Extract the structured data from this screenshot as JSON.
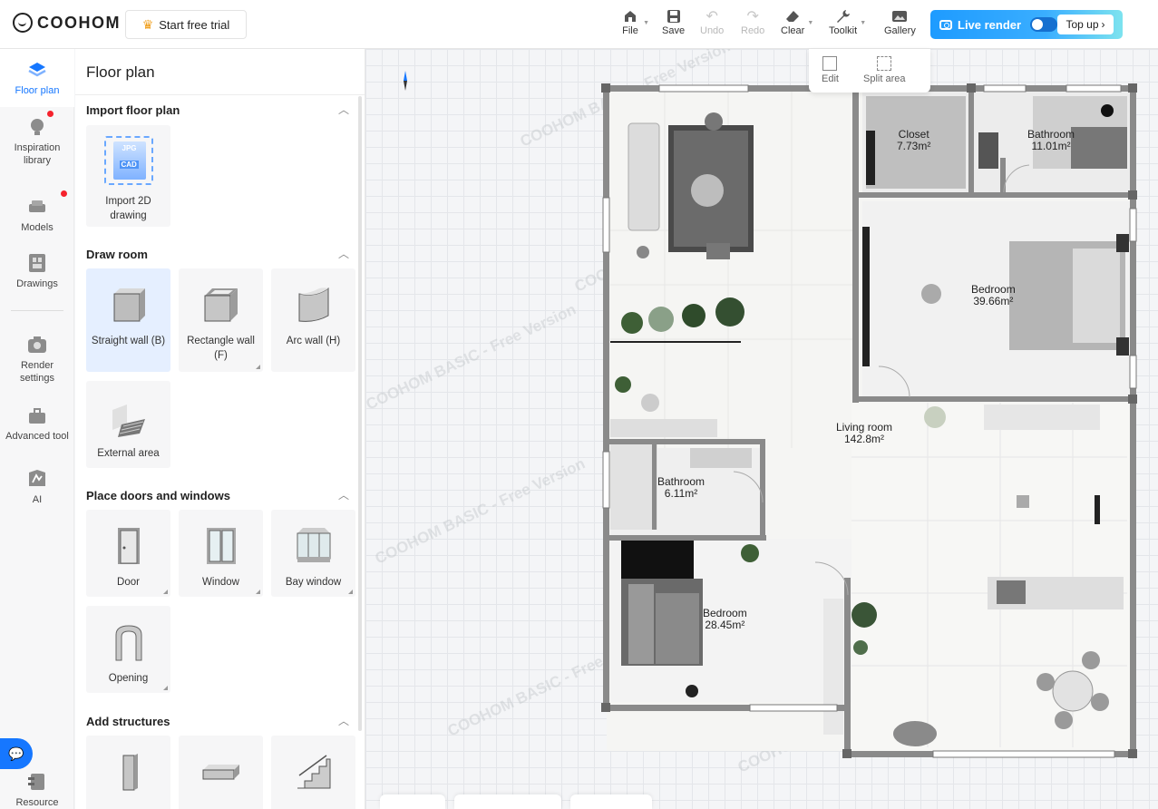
{
  "brand": {
    "name": "COOHOM"
  },
  "trial": {
    "label": "Start free trial"
  },
  "toolbar": {
    "file": "File",
    "save": "Save",
    "undo": "Undo",
    "redo": "Redo",
    "clear": "Clear",
    "toolkit": "Toolkit",
    "gallery": "Gallery"
  },
  "live_render": {
    "label": "Live render",
    "top_up": "Top up"
  },
  "edit_popup": {
    "edit": "Edit",
    "split_area": "Split area"
  },
  "rail": {
    "floor_plan": "Floor plan",
    "inspiration": "Inspiration library",
    "models": "Models",
    "drawings": "Drawings",
    "render_settings": "Render settings",
    "advanced_tool": "Advanced tool",
    "ai": "AI",
    "resource": "Resource"
  },
  "panel": {
    "title": "Floor plan",
    "import": {
      "heading": "Import floor plan",
      "item": "Import 2D drawing",
      "badge_top": "JPG",
      "badge_bottom": "CAD"
    },
    "draw_room": {
      "heading": "Draw room",
      "items": [
        "Straight wall (B)",
        "Rectangle wall (F)",
        "Arc wall (H)",
        "External area"
      ]
    },
    "doors_windows": {
      "heading": "Place doors and windows",
      "items": [
        "Door",
        "Window",
        "Bay window",
        "Opening"
      ]
    },
    "structures": {
      "heading": "Add structures"
    }
  },
  "rooms": {
    "closet": {
      "name": "Closet",
      "area": "7.73m²"
    },
    "bathroom_top": {
      "name": "Bathroom",
      "area": "11.01m²"
    },
    "bedroom_right": {
      "name": "Bedroom",
      "area": "39.66m²"
    },
    "living_room": {
      "name": "Living room",
      "area": "142.8m²"
    },
    "bathroom_small": {
      "name": "Bathroom",
      "area": "6.11m²"
    },
    "bedroom_left": {
      "name": "Bedroom",
      "area": "28.45m²"
    }
  },
  "watermark": {
    "text": "COOHOM BASIC - Free Version"
  },
  "colors": {
    "accent": "#1677ff",
    "live_render_start": "#1e9bff",
    "live_render_end": "#7de3ef",
    "wall": "#8a8a8a",
    "notification": "#f5222d"
  }
}
